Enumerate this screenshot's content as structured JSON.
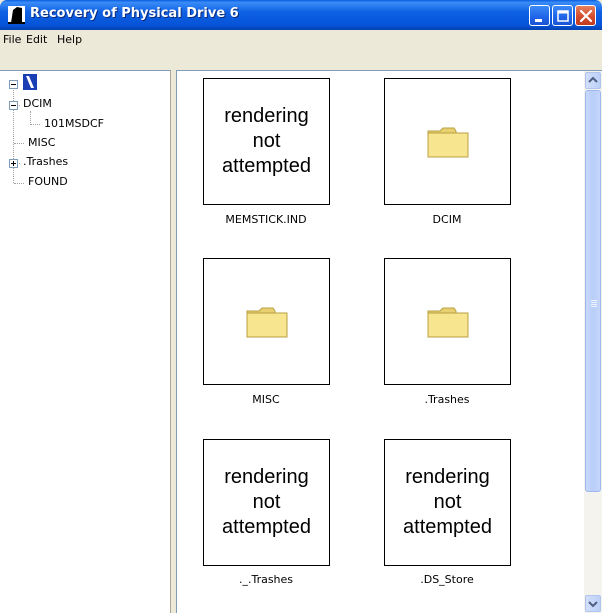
{
  "window": {
    "title": "Recovery of Physical Drive 6",
    "accent": "#0653d8",
    "close_color": "#d2492b"
  },
  "menu": {
    "file": "File",
    "edit": "Edit",
    "help": "Help"
  },
  "tree": {
    "root_icon": "drive-icon",
    "items": [
      {
        "label": "DCIM",
        "expanded": true
      },
      {
        "label": "101MSDCF"
      },
      {
        "label": "MISC"
      },
      {
        "label": ".Trashes",
        "expanded": false
      },
      {
        "label": "FOUND"
      }
    ]
  },
  "files": [
    {
      "name": "MEMSTICK.IND",
      "kind": "preview",
      "preview_lines": [
        "rendering",
        "not",
        "attempted"
      ]
    },
    {
      "name": "DCIM",
      "kind": "folder",
      "icon": "folder-icon"
    },
    {
      "name": "MISC",
      "kind": "folder",
      "icon": "folder-icon"
    },
    {
      "name": ".Trashes",
      "kind": "folder",
      "icon": "folder-icon"
    },
    {
      "name": "._.Trashes",
      "kind": "preview",
      "preview_lines": [
        "rendering",
        "not",
        "attempted"
      ]
    },
    {
      "name": ".DS_Store",
      "kind": "preview",
      "preview_lines": [
        "rendering",
        "not",
        "attempted"
      ]
    }
  ],
  "scroll": {
    "thumb_fraction": 0.78,
    "position_fraction": 0.0
  }
}
